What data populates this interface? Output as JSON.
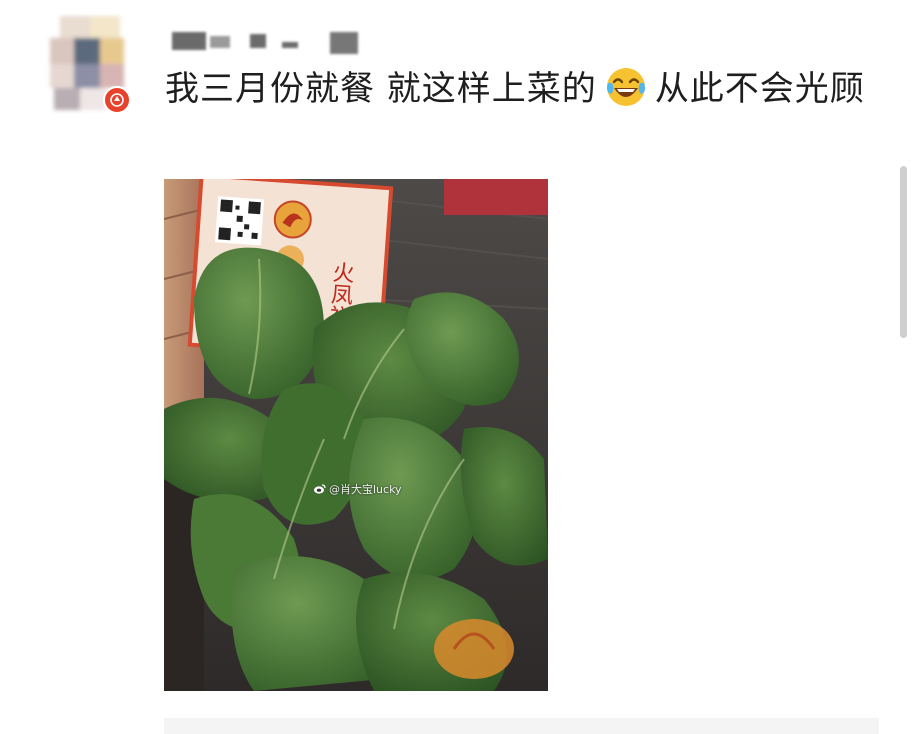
{
  "post": {
    "author_name": "",
    "text_part1": "我三月份就餐 就这样上菜的",
    "emoji": "laughing-with-tears-emoji",
    "text_part2": "从此不会光顾"
  },
  "photo": {
    "description_icons": [
      "qr-code",
      "restaurant-sign",
      "leafy-greens"
    ],
    "sign_text": "火凤祥",
    "watermark": "@肖大宝lucky"
  },
  "colors": {
    "badge": "#e8412c",
    "text": "#1e1e1e",
    "scrollbar": "#cfcfcf"
  }
}
